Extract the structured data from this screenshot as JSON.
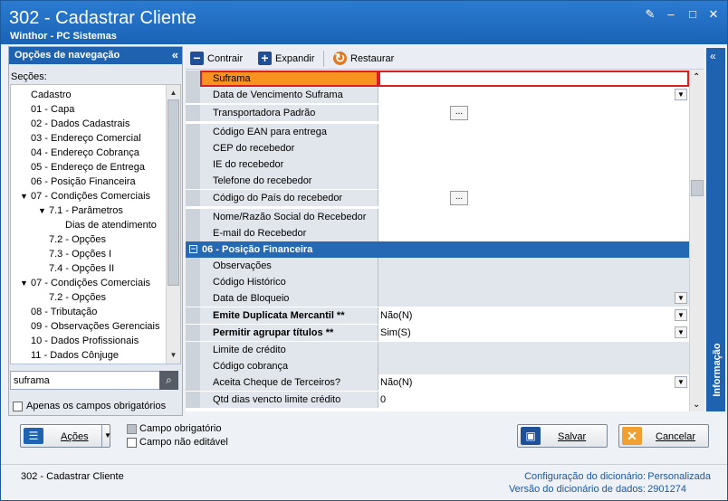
{
  "window": {
    "title": "302 - Cadastrar Cliente",
    "subtitle": "Winthor - PC Sistemas"
  },
  "nav": {
    "title": "Opções de navegação",
    "sections_label": "Seções:",
    "items": [
      "Cadastro",
      "01 - Capa",
      "02 - Dados Cadastrais",
      "03 - Endereço Comercial",
      "04 - Endereço Cobrança",
      "05 - Endereço de Entrega",
      "06 - Posição Financeira",
      "07 - Condições Comerciais",
      "7.1 - Parâmetros",
      "Dias de atendimento",
      "7.2 - Opções",
      "7.3 - Opções I",
      "7.4 - Opções II",
      "07 - Condições Comerciais",
      "7.2 - Opções",
      "08 - Tributação",
      "09 - Observações Gerenciais",
      "10 - Dados Profissionais",
      "11 - Dados Cônjuge"
    ],
    "search_value": "suframa",
    "only_required_label": "Apenas os campos obrigatórios"
  },
  "toolbar": {
    "collapse": "Contrair",
    "expand": "Expandir",
    "restore": "Restaurar"
  },
  "fields": [
    {
      "name": "Suframa",
      "value": ""
    },
    {
      "name": "Data de Vencimento Suframa",
      "value": ""
    },
    {
      "name": "Transportadora Padrão",
      "value": ""
    },
    {
      "name": "Código EAN para entrega",
      "value": ""
    },
    {
      "name": "CEP do recebedor",
      "value": ""
    },
    {
      "name": "IE do recebedor",
      "value": ""
    },
    {
      "name": "Telefone do recebedor",
      "value": ""
    },
    {
      "name": "Código do País do recebedor",
      "value": ""
    },
    {
      "name": "Nome/Razão Social do Recebedor",
      "value": ""
    },
    {
      "name": "E-mail do Recebedor",
      "value": ""
    }
  ],
  "section": {
    "label": "06 - Posição Financeira"
  },
  "fields2": [
    {
      "name": "Observações",
      "value": ""
    },
    {
      "name": "Código Histórico",
      "value": ""
    },
    {
      "name": "Data de Bloqueio",
      "value": ""
    },
    {
      "name": "Emite Duplicata Mercantil **",
      "value": "Não(N)"
    },
    {
      "name": "Permitir agrupar títulos **",
      "value": "Sim(S)"
    },
    {
      "name": "Limite de crédito",
      "value": ""
    },
    {
      "name": "Código cobrança",
      "value": ""
    },
    {
      "name": "Aceita Cheque de Terceiros?",
      "value": "Não(N)"
    },
    {
      "name": "Qtd dias vencto limite crédito",
      "value": "0"
    }
  ],
  "side_tab": "Informação",
  "actions": {
    "label": "Ações",
    "legend_required": "Campo obrigatório",
    "legend_readonly": "Campo não editável",
    "save": "Salvar",
    "cancel": "Cancelar"
  },
  "footer": {
    "title": "302 - Cadastrar Cliente",
    "dict_config_label": "Configuração do dicionário:",
    "dict_config_value": "Personalizada",
    "dict_version_label": "Versão do dicionário de dados:",
    "dict_version_value": "2901274"
  }
}
